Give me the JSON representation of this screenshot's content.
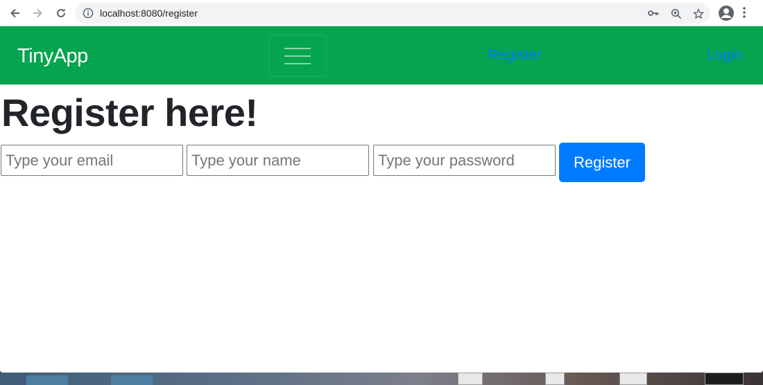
{
  "browser": {
    "url": "localhost:8080/register"
  },
  "icons": {
    "back": "arrow-left-icon",
    "forward": "arrow-right-icon",
    "reload": "reload-icon",
    "info": "info-icon",
    "key": "key-icon",
    "zoom": "zoom-icon",
    "bookmark": "star-icon",
    "profile": "profile-icon",
    "menu": "kebab-menu-icon",
    "toggler": "hamburger-icon"
  },
  "navbar": {
    "brand": "TinyApp",
    "links": [
      "Register",
      "Login"
    ]
  },
  "page": {
    "heading": "Register here!"
  },
  "form": {
    "email_placeholder": "Type your email",
    "name_placeholder": "Type your name",
    "password_placeholder": "Type your password",
    "submit_label": "Register"
  },
  "colors": {
    "navbar_bg": "#05a44f",
    "link": "#007bff",
    "button_bg": "#007bff",
    "heading": "#212529"
  }
}
